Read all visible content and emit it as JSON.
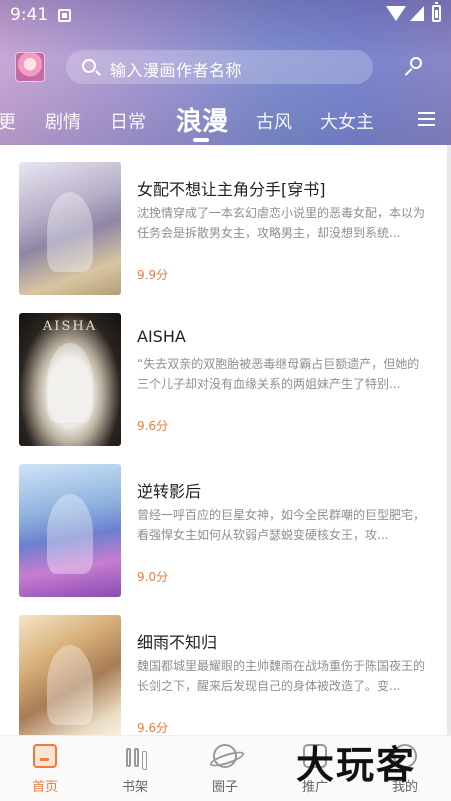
{
  "status_bar": {
    "time": "9:41"
  },
  "search": {
    "placeholder": "输入漫画作者名称"
  },
  "tabs": [
    {
      "label": "更"
    },
    {
      "label": "剧情"
    },
    {
      "label": "日常"
    },
    {
      "label": "浪漫",
      "active": true
    },
    {
      "label": "古风"
    },
    {
      "label": "大女主"
    }
  ],
  "comics": [
    {
      "title": "女配不想让主角分手[穿书]",
      "description": "沈挽情穿成了一本玄幻虐恋小说里的恶毒女配，本以为任务会是拆散男女主，攻略男主，却没想到系统...",
      "score": "9.9分"
    },
    {
      "title": "AISHA",
      "cover_text": "AISHA",
      "description": "“失去双亲的双胞胎被恶毒继母霸占巨额遗产，但她的三个儿子却对没有血缘关系的两姐妹产生了特别...",
      "score": "9.6分"
    },
    {
      "title": "逆转影后",
      "description": "曾经一呼百应的巨星女神，如今全民群嘲的巨型肥宅，看强悍女主如何从软弱卢瑟蜕变硬核女王，攻...",
      "score": "9.0分"
    },
    {
      "title": "细雨不知归",
      "description": "魏国都城里最耀眼的主帅魏雨在战场重伤于陈国夜王的长剑之下，醒来后发现自己的身体被改造了。变...",
      "score": "9.6分"
    }
  ],
  "bottom_nav": [
    {
      "label": "首页",
      "icon": "home-icon",
      "active": true
    },
    {
      "label": "书架",
      "icon": "bookshelf-icon"
    },
    {
      "label": "圈子",
      "icon": "planet-icon"
    },
    {
      "label": "推广",
      "icon": "promote-icon"
    },
    {
      "label": "我的",
      "icon": "profile-icon"
    }
  ],
  "watermark": "大玩客",
  "colors": {
    "accent": "#f07a3a",
    "header_start": "#c9a8d6",
    "header_end": "#7b86cf"
  }
}
